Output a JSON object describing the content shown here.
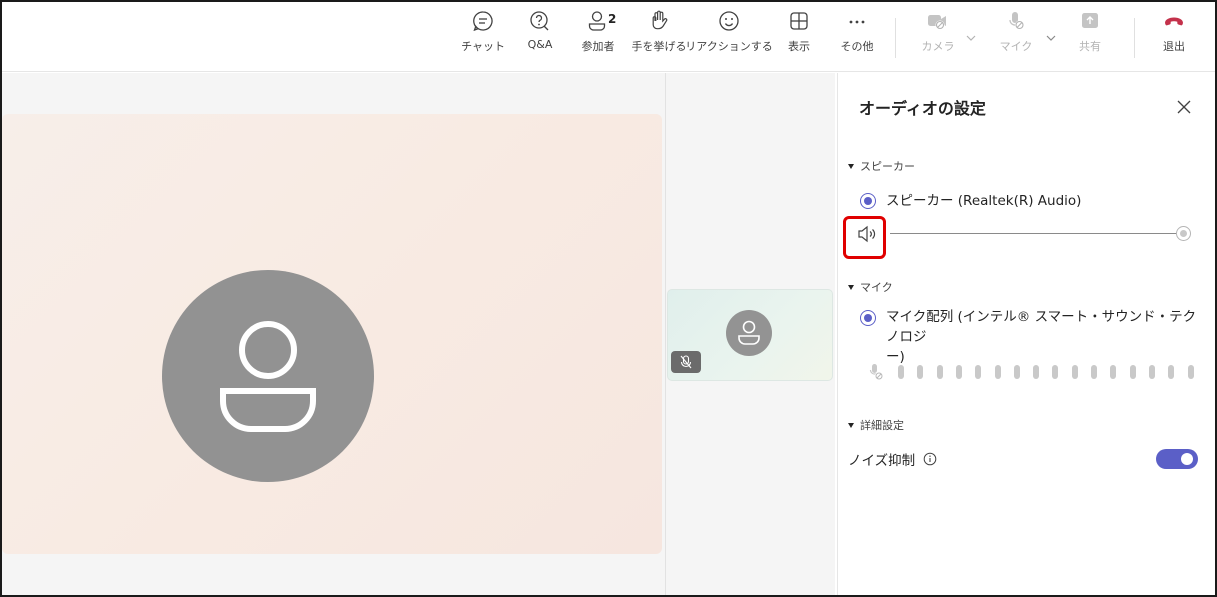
{
  "toolbar": {
    "items": [
      {
        "label": "チャット",
        "icon": "chat-icon"
      },
      {
        "label": "Q&A",
        "icon": "qa-icon"
      },
      {
        "label": "参加者",
        "icon": "participants-icon",
        "count": "2"
      },
      {
        "label": "手を挙げる",
        "icon": "raise-hand-icon"
      },
      {
        "label": "リアクションする",
        "icon": "reaction-icon"
      },
      {
        "label": "表示",
        "icon": "view-icon"
      },
      {
        "label": "その他",
        "icon": "more-icon"
      },
      {
        "label": "カメラ",
        "icon": "camera-off-icon",
        "disabled": true
      },
      {
        "label": "マイク",
        "icon": "mic-off-icon",
        "disabled": true
      },
      {
        "label": "共有",
        "icon": "share-icon",
        "disabled": true
      },
      {
        "label": "退出",
        "icon": "leave-icon",
        "color": "#c4314b"
      }
    ]
  },
  "panel": {
    "title": "オーディオの設定",
    "speaker_section": {
      "header": "スピーカー",
      "device": "スピーカー (Realtek(R) Audio)",
      "volume_percent": 100
    },
    "mic_section": {
      "header": "マイク",
      "device": "マイク配列 (インテル® スマート・サウンド・テクノロジ ー)",
      "device_line1": "マイク配列 (インテル® スマート・サウンド・テクノロジ",
      "device_line2": "ー)",
      "level_percent": 0
    },
    "advanced_section": {
      "header": "詳細設定",
      "noise_suppression_label": "ノイズ抑制",
      "noise_suppression_on": true
    }
  },
  "colors": {
    "accent": "#5b5fc7",
    "leave": "#c4314b",
    "highlight": "#e00000"
  }
}
